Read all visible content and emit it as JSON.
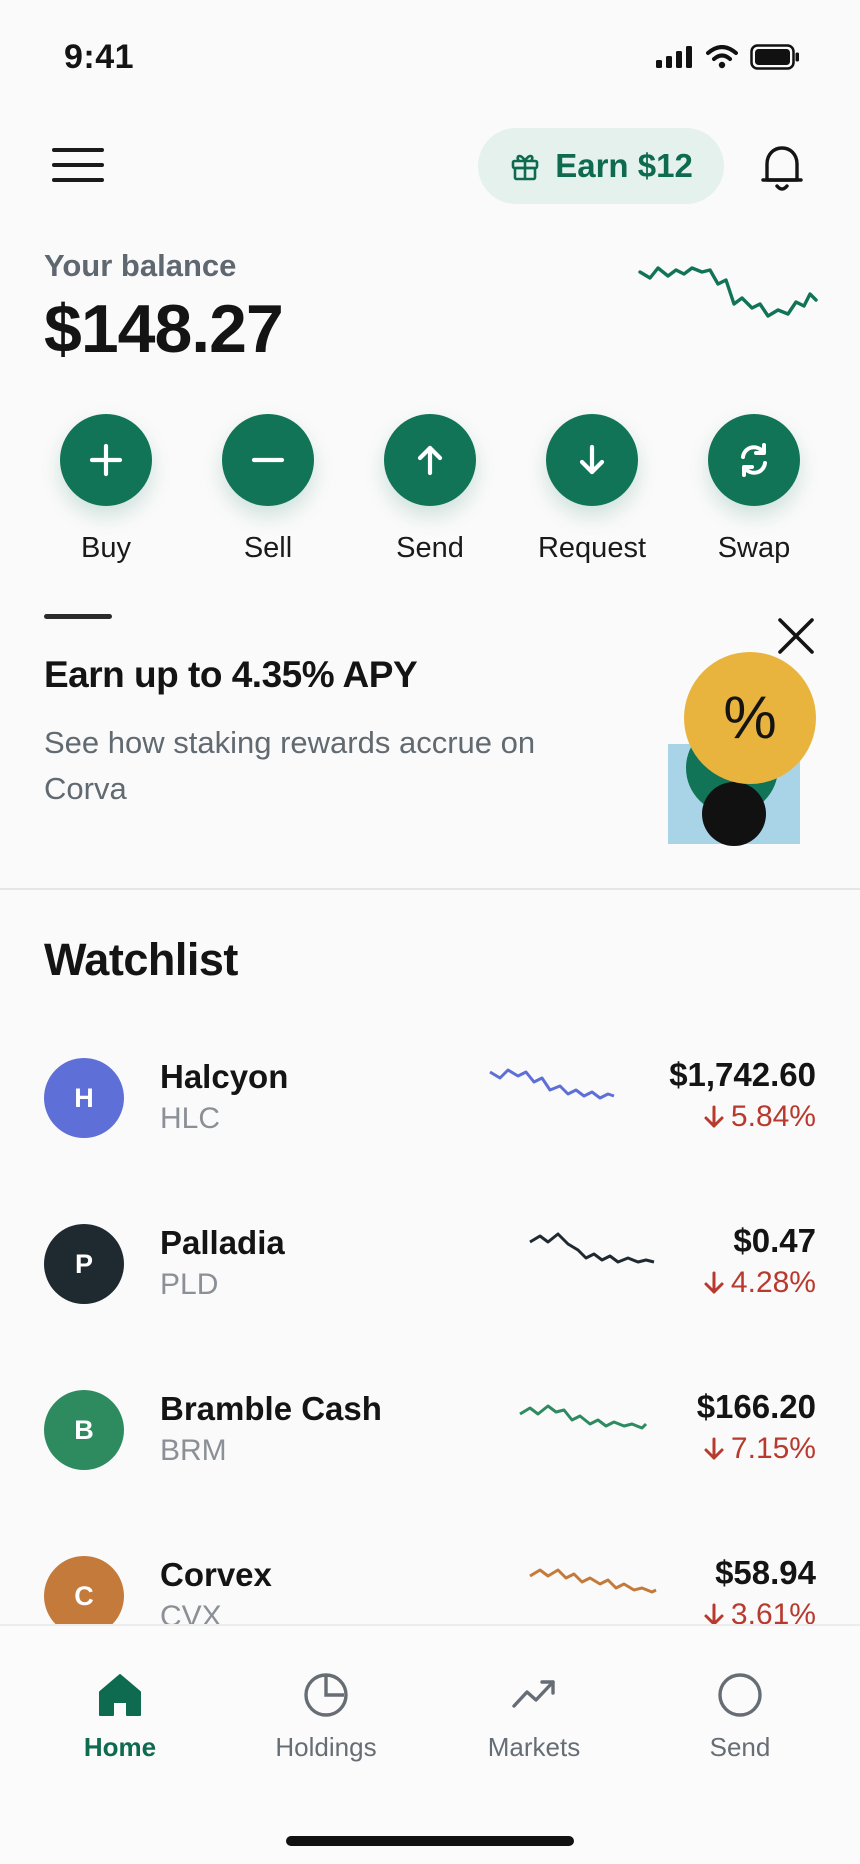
{
  "status_bar": {
    "time": "9:41"
  },
  "header": {
    "earn_label": "Earn $12"
  },
  "balance": {
    "label": "Your balance",
    "amount": "$148.27"
  },
  "actions": [
    {
      "label": "Buy",
      "icon": "plus-icon"
    },
    {
      "label": "Sell",
      "icon": "minus-icon"
    },
    {
      "label": "Send",
      "icon": "arrow-up-icon"
    },
    {
      "label": "Request",
      "icon": "arrow-down-icon"
    },
    {
      "label": "Swap",
      "icon": "swap-icon"
    }
  ],
  "promo": {
    "title": "Earn up to 4.35% APY",
    "description": "See how staking rewards accrue on Corva",
    "badge": "%"
  },
  "watchlist": {
    "title": "Watchlist",
    "items": [
      {
        "initial": "H",
        "name": "Halcyon",
        "ticker": "HLC",
        "price": "$1,742.60",
        "change": "5.84%",
        "direction": "down",
        "color": "#5e6fd8"
      },
      {
        "initial": "P",
        "name": "Palladia",
        "ticker": "PLD",
        "price": "$0.47",
        "change": "4.28%",
        "direction": "down",
        "color": "#1f2a30"
      },
      {
        "initial": "B",
        "name": "Bramble Cash",
        "ticker": "BRM",
        "price": "$166.20",
        "change": "7.15%",
        "direction": "down",
        "color": "#2e8b5f"
      },
      {
        "initial": "C",
        "name": "Corvex",
        "ticker": "CVX",
        "price": "$58.94",
        "change": "3.61%",
        "direction": "down",
        "color": "#c47a3a"
      }
    ]
  },
  "nav": {
    "items": [
      {
        "label": "Home",
        "icon": "home-icon",
        "active": true
      },
      {
        "label": "Holdings",
        "icon": "pie-chart-icon",
        "active": false
      },
      {
        "label": "Markets",
        "icon": "trend-icon",
        "active": false
      },
      {
        "label": "Send",
        "icon": "circle-icon",
        "active": false
      }
    ]
  },
  "colors": {
    "accent": "#117457",
    "negative": "#b83a2e"
  }
}
